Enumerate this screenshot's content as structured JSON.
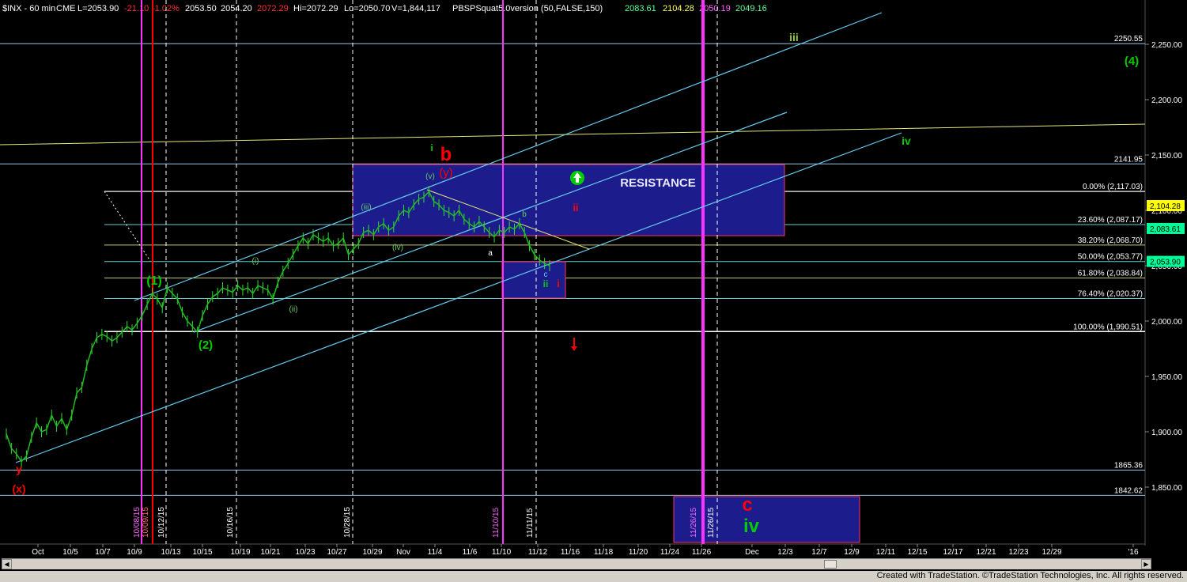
{
  "header": {
    "symbol": "$INX - 60 min",
    "exchange": "CME",
    "last": "L=2053.90",
    "change": "-21.10",
    "pct": "-1.02%",
    "open": "2053.50",
    "high_low_pair": "2054.20",
    "prev": "2072.29",
    "hi": "Hi=2072.29",
    "lo": "Lo=2050.70",
    "vol": "V=1,844,117",
    "study": "PBSPSquat5.0version (50,FALSE,150)",
    "v1": "2083.61",
    "v2": "2104.28",
    "v3": "2050.19",
    "v4": "2049.16"
  },
  "colors": {
    "background": "#000000",
    "cyan": "#66ccff",
    "yellow": "#e6e67a",
    "magenta": "#ff33ff",
    "red": "#ff0000",
    "green": "#00cc00",
    "lightgreen": "#66ff66",
    "box_fill": "#1c1c8c",
    "box_border": "#ff3366"
  },
  "chart_data": {
    "type": "line",
    "title": "$INX - 60 min",
    "ylim": [
      1815,
      2287
    ],
    "y_ticks": [
      "2,250.00",
      "2,200.00",
      "2,150.00",
      "2,100.00",
      "2,050.00",
      "2,000.00",
      "1,950.00",
      "1,900.00",
      "1,850.00"
    ],
    "x_ticks": [
      "Oct",
      "10/5",
      "10/7",
      "10/9",
      "10/13",
      "10/15",
      "10/19",
      "10/21",
      "10/23",
      "10/27",
      "10/29",
      "Nov",
      "11/4",
      "11/6",
      "11/10",
      "11/12",
      "11/16",
      "11/18",
      "11/20",
      "11/24",
      "11/26",
      "Dec",
      "12/3",
      "12/7",
      "12/9",
      "12/11",
      "12/15",
      "12/17",
      "12/21",
      "12/23",
      "12/29",
      "'16"
    ],
    "series": [
      {
        "values": [
          1898,
          1885,
          1880,
          1873,
          1878,
          1895,
          1908,
          1900,
          1902,
          1915,
          1905,
          1912,
          1902,
          1915,
          1935,
          1940,
          1960,
          1975,
          1985,
          1988,
          1986,
          1982,
          1985,
          1990,
          1995,
          1992,
          1998,
          2005,
          2015,
          2025,
          2020,
          2012,
          2030,
          2025,
          2020,
          2008,
          2000,
          1995,
          1990,
          2005,
          2015,
          2022,
          2025,
          2030,
          2028,
          2026,
          2032,
          2028,
          2030,
          2025,
          2032,
          2030,
          2028,
          2020,
          2035,
          2045,
          2052,
          2060,
          2068,
          2075,
          2070,
          2078,
          2075,
          2072,
          2075,
          2068,
          2070,
          2075,
          2060,
          2065,
          2070,
          2080,
          2082,
          2078,
          2085,
          2088,
          2082,
          2085,
          2095,
          2100,
          2098,
          2105,
          2110,
          2112,
          2117,
          2108,
          2105,
          2100,
          2098,
          2095,
          2100,
          2092,
          2088,
          2085,
          2090,
          2085,
          2080,
          2076,
          2082,
          2080,
          2085,
          2083,
          2088,
          2080,
          2068,
          2060,
          2055,
          2052,
          2050
        ]
      }
    ],
    "horizontal_levels": [
      {
        "label": "2250.55",
        "value": 2250.55
      },
      {
        "label": "2141.95",
        "value": 2141.95
      },
      {
        "label": "1865.36",
        "value": 1865.36
      },
      {
        "label": "1842.62",
        "value": 1842.62
      }
    ],
    "fib_levels": [
      {
        "label": "0.00% (2,117.03)",
        "value": 2117.03
      },
      {
        "label": "23.60% (2,087.17)",
        "value": 2087.17
      },
      {
        "label": "38.20% (2,068.70)",
        "value": 2068.7
      },
      {
        "label": "50.00% (2,053.77)",
        "value": 2053.77
      },
      {
        "label": "61.80% (2,038.84)",
        "value": 2038.84
      },
      {
        "label": "76.40% (2,020.37)",
        "value": 2020.37
      },
      {
        "label": "100.00% (1,990.51)",
        "value": 1990.51
      }
    ],
    "price_tags": [
      {
        "label": "2,104.28",
        "value": 2104.28,
        "color": "#ffff00"
      },
      {
        "label": "2,083.61",
        "value": 2083.61,
        "color": "#00ff99"
      },
      {
        "label": "2,053.90",
        "value": 2053.9,
        "color": "#00ff99"
      }
    ],
    "date_labels": [
      "10/08/15",
      "10/09/15",
      "10/12/15",
      "10/16/15",
      "10/28/15",
      "11/10/15",
      "11/11/15",
      "11/26/15",
      "11/26/15"
    ],
    "box_labels": [
      "RESISTANCE"
    ],
    "wave_labels": [
      "(1)",
      "(2)",
      "(i)",
      "(ii)",
      "(iii)",
      "(iv)",
      "(v)",
      "i",
      "b",
      "(y)",
      "y",
      "(x)",
      "ii",
      "a",
      "b",
      "c",
      "ii",
      "i",
      "iii",
      "iv",
      "(4)",
      "c",
      "iv"
    ]
  },
  "footer": {
    "credit": "Created with TradeStation. ©TradeStation Technologies, Inc. All rights reserved."
  }
}
